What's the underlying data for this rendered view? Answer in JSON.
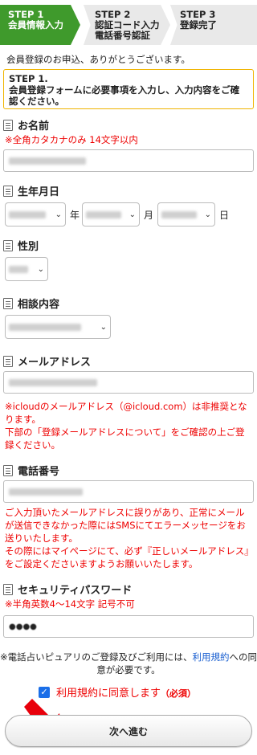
{
  "steps": [
    {
      "n": "STEP 1",
      "label": "会員情報入力"
    },
    {
      "n": "STEP 2",
      "label": "認証コード入力\n電話番号認証",
      "label1": "認証コード入力",
      "label2": "電話番号認証"
    },
    {
      "n": "STEP 3",
      "label": "登録完了"
    }
  ],
  "intro": "会員登録のお申込、ありがとうございます。",
  "notice": {
    "title": "STEP 1.",
    "body": "会員登録フォームに必要事項を入力し、入力内容をご確認ください。"
  },
  "fields": {
    "name": {
      "label": "お名前",
      "hint": "※全角カタカナのみ 14文字以内"
    },
    "birthday": {
      "label": "生年月日",
      "year_suffix": "年",
      "month_suffix": "月",
      "day_suffix": "日"
    },
    "gender": {
      "label": "性別"
    },
    "consult": {
      "label": "相談内容"
    },
    "email": {
      "label": "メールアドレス",
      "note1": "※icloudのメールアドレス（@icloud.com）は非推奨となります。",
      "note2": "下部の「登録メールアドレスについて」をご確認の上ご登録ください。"
    },
    "phone": {
      "label": "電話番号",
      "note1": "ご入力頂いたメールアドレスに誤りがあり、正常にメールが送信できなかった際にはSMSにてエラーメッセージをお送りいたします。",
      "note2": "その際にはマイページにて、必ず『正しいメールアドレス』をご設定くださいますようお願いいたします。"
    },
    "password": {
      "label": "セキュリティパスワード",
      "hint": "※半角英数4〜14文字 記号不可",
      "value": "●●●●"
    }
  },
  "agreement": {
    "text1": "※電話占いピュアリのご登録及びご利用には、",
    "link": "利用規約",
    "text2": "への同意が必要です。",
    "checkbox_label": "利用規約に同意します",
    "required": "（必須）"
  },
  "next_button": "次へ進む",
  "colors": {
    "step_active": "#3f9a2c",
    "step_inactive": "#e9e9e9",
    "notice_border": "#f0b400",
    "warning_text": "#ee0000",
    "link": "#1a5fd0",
    "arrow": "#e8000b"
  }
}
